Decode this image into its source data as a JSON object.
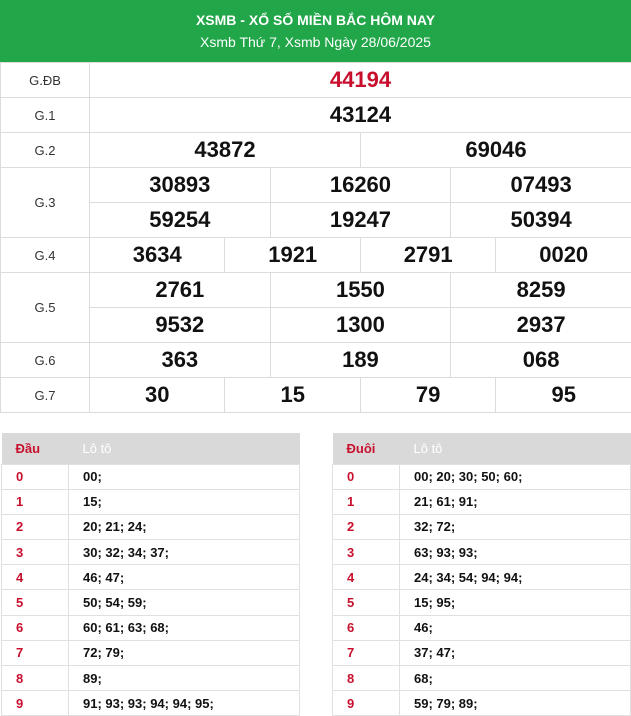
{
  "header": {
    "title": "XSMB - XỔ SỐ MIỀN BẮC HÔM NAY",
    "subtitle": "Xsmb Thứ 7, Xsmb Ngày 28/06/2025"
  },
  "prizes": [
    {
      "label": "G.ĐB",
      "rows": [
        [
          "44194"
        ]
      ]
    },
    {
      "label": "G.1",
      "rows": [
        [
          "43124"
        ]
      ]
    },
    {
      "label": "G.2",
      "rows": [
        [
          "43872",
          "69046"
        ]
      ]
    },
    {
      "label": "G.3",
      "rows": [
        [
          "30893",
          "16260",
          "07493"
        ],
        [
          "59254",
          "19247",
          "50394"
        ]
      ]
    },
    {
      "label": "G.4",
      "rows": [
        [
          "3634",
          "1921",
          "2791",
          "0020"
        ]
      ]
    },
    {
      "label": "G.5",
      "rows": [
        [
          "2761",
          "1550",
          "8259"
        ],
        [
          "9532",
          "1300",
          "2937"
        ]
      ]
    },
    {
      "label": "G.6",
      "rows": [
        [
          "363",
          "189",
          "068"
        ]
      ]
    },
    {
      "label": "G.7",
      "rows": [
        [
          "30",
          "15",
          "79",
          "95"
        ]
      ]
    }
  ],
  "dau": {
    "col1": "Đầu",
    "col2": "Lô tô",
    "rows": [
      {
        "k": "0",
        "v": "00;"
      },
      {
        "k": "1",
        "v": "15;"
      },
      {
        "k": "2",
        "v": "20; 21; 24;"
      },
      {
        "k": "3",
        "v": "30; 32; 34; 37;"
      },
      {
        "k": "4",
        "v": "46; 47;"
      },
      {
        "k": "5",
        "v": "50; 54; 59;"
      },
      {
        "k": "6",
        "v": "60; 61; 63; 68;"
      },
      {
        "k": "7",
        "v": "72; 79;"
      },
      {
        "k": "8",
        "v": "89;"
      },
      {
        "k": "9",
        "v": "91; 93; 93; 94; 94; 95;"
      }
    ]
  },
  "duoi": {
    "col1": "Đuôi",
    "col2": "Lô tô",
    "rows": [
      {
        "k": "0",
        "v": "00; 20; 30; 50; 60;"
      },
      {
        "k": "1",
        "v": "21; 61; 91;"
      },
      {
        "k": "2",
        "v": "32; 72;"
      },
      {
        "k": "3",
        "v": "63; 93; 93;"
      },
      {
        "k": "4",
        "v": "24; 34; 54; 94; 94;"
      },
      {
        "k": "5",
        "v": "15; 95;"
      },
      {
        "k": "6",
        "v": "46;"
      },
      {
        "k": "7",
        "v": "37; 47;"
      },
      {
        "k": "8",
        "v": "68;"
      },
      {
        "k": "9",
        "v": "59; 79; 89;"
      }
    ]
  },
  "colors": {
    "header_bg": "#21a649",
    "special_prize": "#c8102e",
    "key_text": "#c8102e"
  }
}
